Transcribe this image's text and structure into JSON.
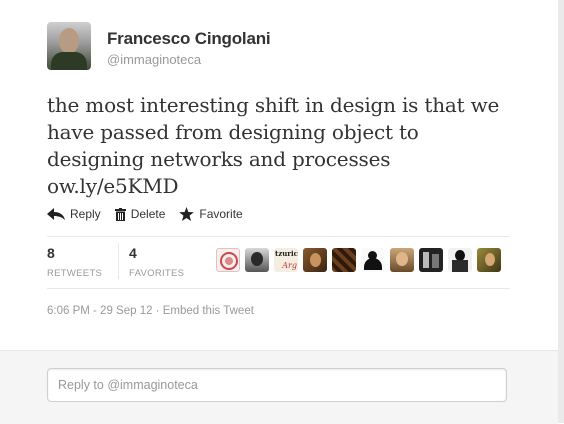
{
  "author": {
    "name": "Francesco Cingolani",
    "handle": "@immaginoteca"
  },
  "tweet": {
    "text": "the most interesting shift in design is that we\nhave passed from designing object to\ndesigning networks and processes\now.ly/e5KMD"
  },
  "actions": [
    {
      "label": "Reply",
      "icon": "reply-icon"
    },
    {
      "label": "Delete",
      "icon": "trash-icon"
    },
    {
      "label": "Favorite",
      "icon": "star-icon"
    }
  ],
  "stats": {
    "retweets": {
      "count": "8",
      "label": "RETWEETS"
    },
    "favorites": {
      "count": "4",
      "label": "FAVORITES"
    }
  },
  "faces": [
    {
      "icon": "user-avatar-seal"
    },
    {
      "icon": "user-avatar-portrait"
    },
    {
      "icon": "user-avatar-text-logo",
      "lines": [
        "tzuric",
        "Arg"
      ]
    },
    {
      "icon": "user-avatar-portrait"
    },
    {
      "icon": "user-avatar-pattern"
    },
    {
      "icon": "user-avatar-silhouette"
    },
    {
      "icon": "user-avatar-portrait"
    },
    {
      "icon": "user-avatar-portrait"
    },
    {
      "icon": "user-avatar-portrait"
    },
    {
      "icon": "user-avatar-portrait"
    }
  ],
  "meta": {
    "time": "6:06 PM - 29 Sep 12",
    "separator": " · ",
    "embed": "Embed this Tweet"
  },
  "reply": {
    "placeholder": "Reply to @immaginoteca"
  },
  "colors": {
    "text": "#333333",
    "muted": "#999999",
    "divider": "#e8e8e8",
    "reply_bg": "#f5f5f5"
  }
}
